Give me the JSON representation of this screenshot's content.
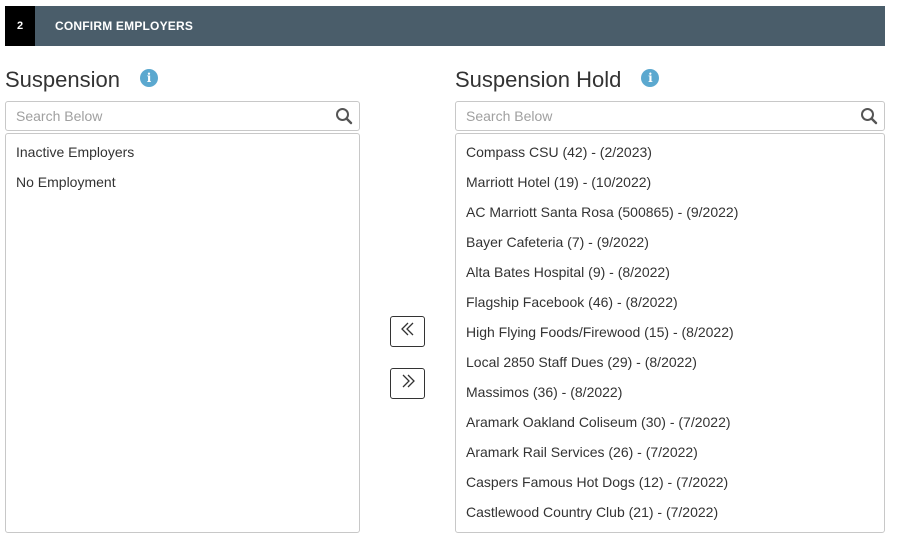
{
  "step": {
    "number": "2",
    "title": "CONFIRM EMPLOYERS"
  },
  "left_panel": {
    "title": "Suspension",
    "search_placeholder": "Search Below",
    "items": [
      {
        "label": "Inactive Employers"
      },
      {
        "label": "No Employment"
      }
    ]
  },
  "right_panel": {
    "title": "Suspension Hold",
    "search_placeholder": "Search Below",
    "items": [
      {
        "label": "Compass CSU (42) - (2/2023)"
      },
      {
        "label": "Marriott Hotel (19) - (10/2022)"
      },
      {
        "label": "AC Marriott Santa Rosa (500865) - (9/2022)"
      },
      {
        "label": "Bayer Cafeteria (7) - (9/2022)"
      },
      {
        "label": "Alta Bates Hospital (9) - (8/2022)"
      },
      {
        "label": "Flagship Facebook (46) - (8/2022)"
      },
      {
        "label": "High Flying Foods/Firewood (15) - (8/2022)"
      },
      {
        "label": "Local 2850 Staff Dues (29) - (8/2022)"
      },
      {
        "label": "Massimos (36) - (8/2022)"
      },
      {
        "label": "Aramark Oakland Coliseum (30) - (7/2022)"
      },
      {
        "label": "Aramark Rail Services (26) - (7/2022)"
      },
      {
        "label": "Caspers Famous Hot Dogs (12) - (7/2022)"
      },
      {
        "label": "Castlewood Country Club (21) - (7/2022)"
      }
    ]
  },
  "icons": {
    "info": "info-icon",
    "search": "search-icon",
    "move_left": "double-chevron-left-icon",
    "move_right": "double-chevron-right-icon"
  },
  "colors": {
    "header_bg": "#4a5d6a",
    "step_number_bg": "#000000",
    "info_icon": "#5ba8cf"
  }
}
